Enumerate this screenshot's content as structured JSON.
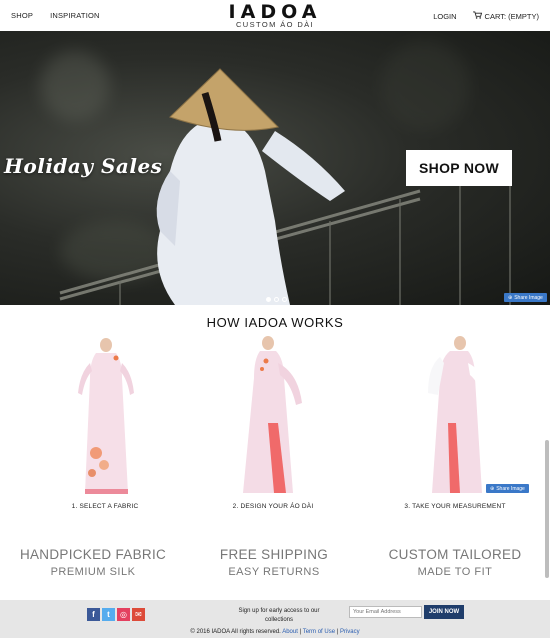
{
  "header": {
    "nav_left": [
      "SHOP",
      "INSPIRATION"
    ],
    "brand": "IADOA",
    "tagline": "CUSTOM ÁO DÀI",
    "login": "LOGIN",
    "cart": "CART: (EMPTY)"
  },
  "hero": {
    "title": "Holiday Sales",
    "cta": "SHOP NOW",
    "share": "Share Image",
    "slides": 3,
    "active_slide": 1
  },
  "how": {
    "title": "HOW IADOA WORKS",
    "steps": [
      {
        "caption": "1. SELECT A FABRIC"
      },
      {
        "caption": "2. DESIGN YOUR ÁO DÀI"
      },
      {
        "caption": "3. TAKE YOUR MEASUREMENT"
      }
    ],
    "share": "Share Image"
  },
  "features": [
    {
      "line1": "HANDPICKED FABRIC",
      "line2": "PREMIUM SILK"
    },
    {
      "line1": "FREE SHIPPING",
      "line2": "EASY RETURNS"
    },
    {
      "line1": "CUSTOM TAILORED",
      "line2": "MADE TO FIT"
    }
  ],
  "footer": {
    "socials": [
      {
        "icon": "facebook-icon",
        "glyph": "f",
        "color": "#3b5998"
      },
      {
        "icon": "twitter-icon",
        "glyph": "t",
        "color": "#55acee"
      },
      {
        "icon": "instagram-icon",
        "glyph": "◎",
        "color": "#e4405f"
      },
      {
        "icon": "email-icon",
        "glyph": "✉",
        "color": "#dd4b39"
      }
    ],
    "signup_text": "Sign up for early access to our collections",
    "email_placeholder": "Your Email Address",
    "join_label": "JOIN NOW",
    "copyright": "© 2016 IADOA All rights reserved.",
    "links": [
      "About",
      "Term of Use",
      "Privacy"
    ]
  },
  "colors": {
    "accent": "#1f3d6b",
    "share": "#3a78c8",
    "feature_text": "#777777",
    "link": "#2a5db0"
  }
}
